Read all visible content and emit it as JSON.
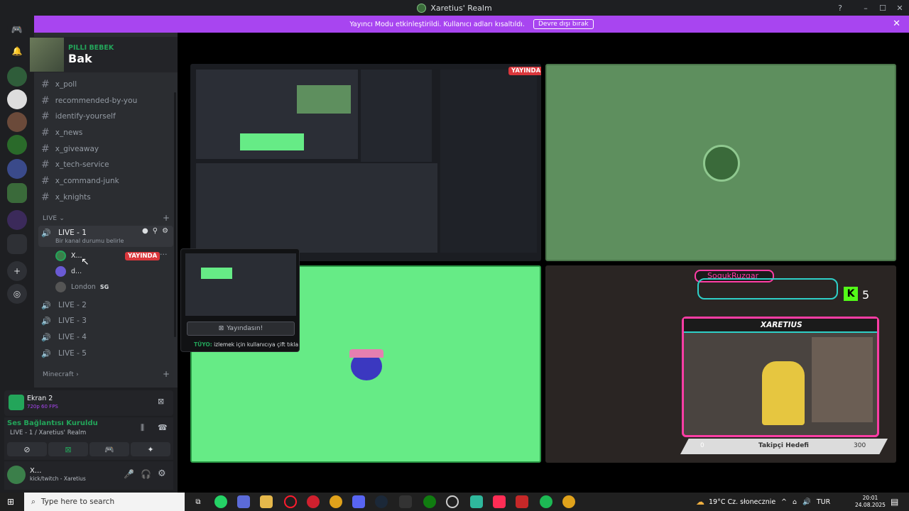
{
  "window": {
    "title": "Xaretius' Realm"
  },
  "banner": {
    "text": "Yayıncı Modu etkinleştirildi. Kullanıcı adları kısaltıldı.",
    "button": "Devre dışı bırak"
  },
  "user_banner": {
    "name": "PILLI BEBEK",
    "subtitle": "Bak"
  },
  "channels": [
    "x_poll",
    "recommended-by-you",
    "identify-yourself",
    "x_news",
    "x_giveaway",
    "x_tech-service",
    "x_command-junk",
    "x_knights"
  ],
  "live_category": {
    "label": "LIVE",
    "voice_channels": [
      {
        "name": "LIVE - 1",
        "status": "Bir kanal durumu belirle"
      },
      {
        "name": "LIVE - 2"
      },
      {
        "name": "LIVE - 3"
      },
      {
        "name": "LIVE - 4"
      },
      {
        "name": "LIVE - 5"
      }
    ]
  },
  "voice_users": [
    {
      "name": "X...",
      "badge": "YAYINDA",
      "color": "#3b7f4a"
    },
    {
      "name": "d...",
      "color": "#6a5ad3"
    },
    {
      "name": "London",
      "tag": "SG",
      "color": "#555"
    }
  ],
  "minecraft_category": "Minecraft",
  "screen_share": {
    "title": "Ekran 2",
    "quality": "720p 60 FPS"
  },
  "voice_status": {
    "title": "Ses Bağlantısı Kuruldu",
    "channel": "LIVE - 1 / Xaretius' Realm"
  },
  "self_user": {
    "name": "X...",
    "status": "kick/twitch - Xaretius"
  },
  "preview": {
    "button": "Yayındasın!",
    "tip_label": "TÜYO:",
    "tip": "izlemek için kullanıcıya çift tıkla"
  },
  "tiles": {
    "live_badge": "YAYINDA"
  },
  "overlay": {
    "username": "SogukRuzgar",
    "kick_count": "5",
    "channel": "XARETIUS",
    "goal_label": "Takipçi Hedefi",
    "goal_current": "0",
    "goal_target": "300",
    "goal_fraction": 0
  },
  "taskbar": {
    "search_placeholder": "Type here to search",
    "weather": "19°C  Cz. słonecznie",
    "lang": "TUR",
    "time": "20:01",
    "date": "24.08.2025"
  },
  "colors": {
    "accent": "#a845f0",
    "live": "#da373c",
    "online": "#23a55a"
  }
}
